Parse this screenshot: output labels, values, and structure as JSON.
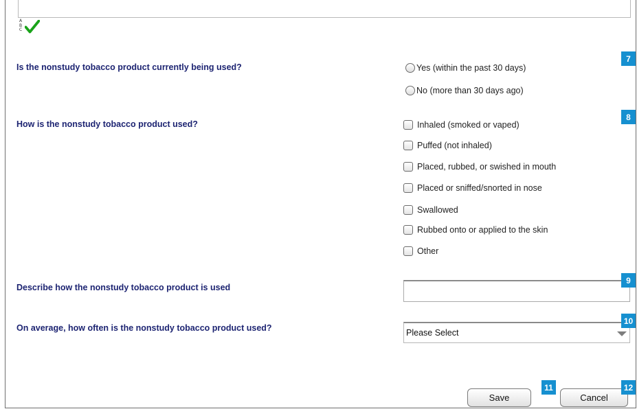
{
  "questions": [
    {
      "label": "Is the nonstudy tobacco product currently being used?",
      "badge": "7",
      "options": [
        "Yes (within the past 30 days)",
        "No (more than 30 days ago)"
      ]
    },
    {
      "label": "How is the nonstudy tobacco product used?",
      "badge": "8",
      "options": [
        "Inhaled (smoked or vaped)",
        "Puffed (not inhaled)",
        "Placed, rubbed, or swished in mouth",
        "Placed or sniffed/snorted in nose",
        "Swallowed",
        "Rubbed onto or applied to the skin",
        "Other"
      ]
    },
    {
      "label": "Describe how the nonstudy tobacco product is used",
      "badge": "9",
      "value": ""
    },
    {
      "label": "On average, how often is the nonstudy tobacco product used?",
      "badge": "10",
      "selected": "Please Select"
    }
  ],
  "spellcheck": {
    "letters": [
      "A",
      "B",
      "C"
    ],
    "icon": "check-icon",
    "color": "#1aa31a"
  },
  "buttons": {
    "save_label": "Save",
    "save_badge": "11",
    "cancel_label": "Cancel",
    "cancel_badge": "12"
  },
  "colors": {
    "question_text": "#1d2472",
    "badge": "#1690d0"
  }
}
